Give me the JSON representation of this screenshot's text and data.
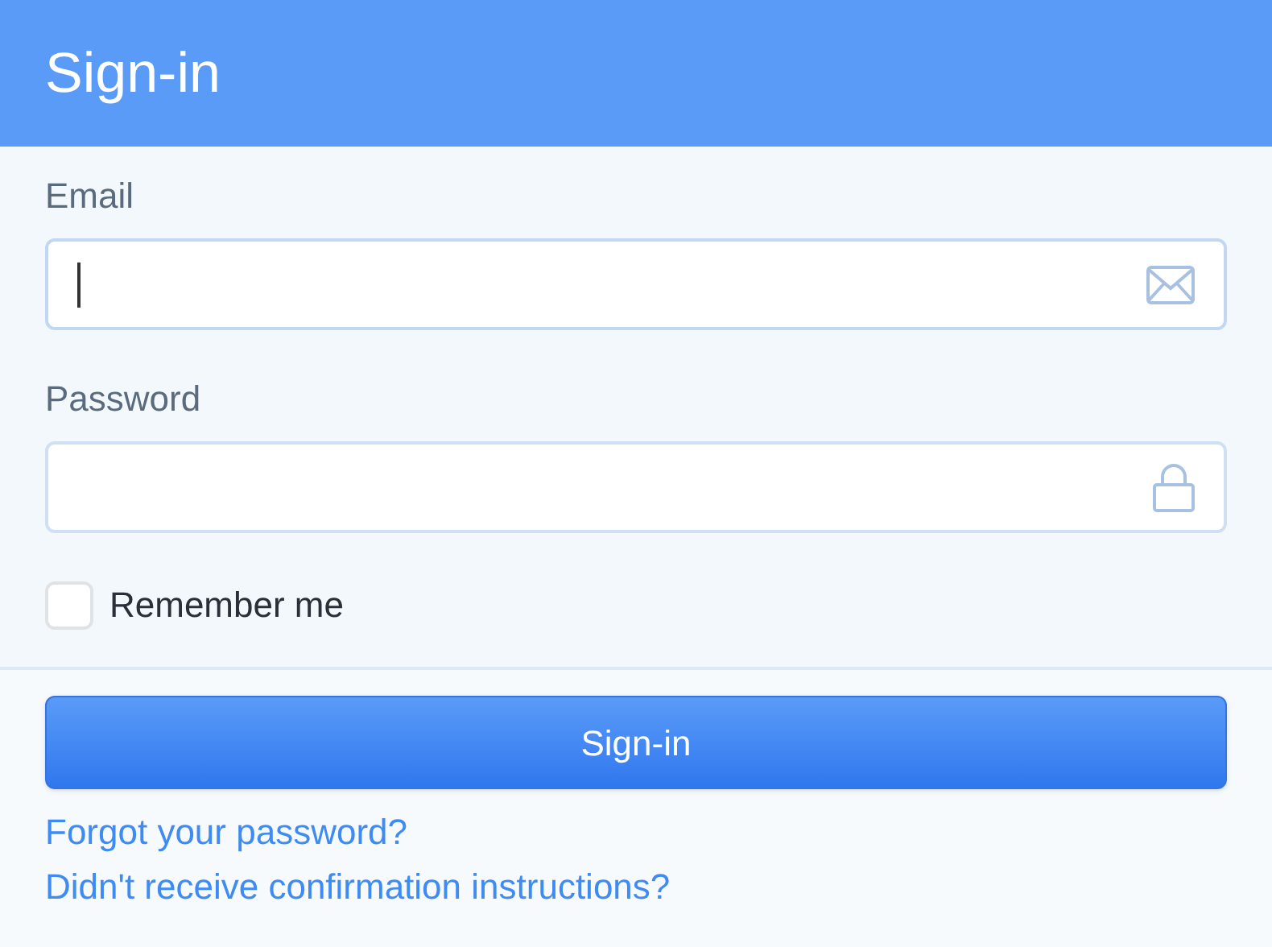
{
  "header": {
    "title": "Sign-in"
  },
  "fields": [
    {
      "label": "Email",
      "kind": "email",
      "focused": true
    },
    {
      "label": "Password",
      "kind": "password",
      "focused": false
    }
  ],
  "remember": {
    "label": "Remember me",
    "checked": false
  },
  "submit": {
    "label": "Sign-in"
  },
  "links": [
    "Forgot your password?",
    "Didn't receive confirmation instructions?"
  ]
}
